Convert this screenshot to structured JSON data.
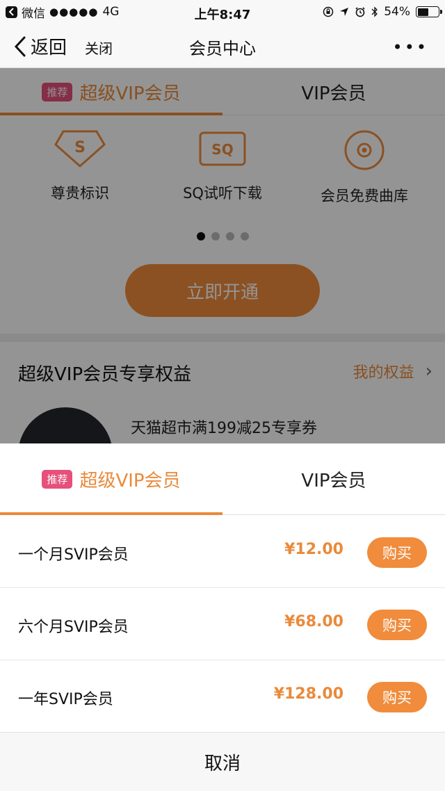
{
  "status_bar": {
    "app": "微信",
    "signal": "●●●●●",
    "network": "4G",
    "time": "上午8:47",
    "battery": "54%",
    "battery_level": 0.54
  },
  "nav": {
    "back": "返回",
    "close": "关闭",
    "title": "会员中心",
    "more": "•••"
  },
  "tabs": {
    "badge": "推荐",
    "svip": "超级VIP会员",
    "vip": "VIP会员"
  },
  "features": [
    {
      "label": "尊贵标识",
      "icon": "s-badge-icon"
    },
    {
      "label": "SQ试听下载",
      "icon": "sq-icon"
    },
    {
      "label": "会员免费曲库",
      "icon": "disc-icon"
    }
  ],
  "carousel": {
    "count": 4,
    "active_index": 0
  },
  "open_button": "立即开通",
  "benefits": {
    "title": "超级VIP会员专享权益",
    "link": "我的权益",
    "first_item": "天猫超市满199减25专享券"
  },
  "plans": [
    {
      "name": "一个月SVIP会员",
      "price": "¥12.00",
      "buy": "购买"
    },
    {
      "name": "六个月SVIP会员",
      "price": "¥68.00",
      "buy": "购买"
    },
    {
      "name": "一年SVIP会员",
      "price": "¥128.00",
      "buy": "购买"
    }
  ],
  "cancel": "取消",
  "colors": {
    "accent": "#f08c3c",
    "badge": "#e6507a"
  }
}
